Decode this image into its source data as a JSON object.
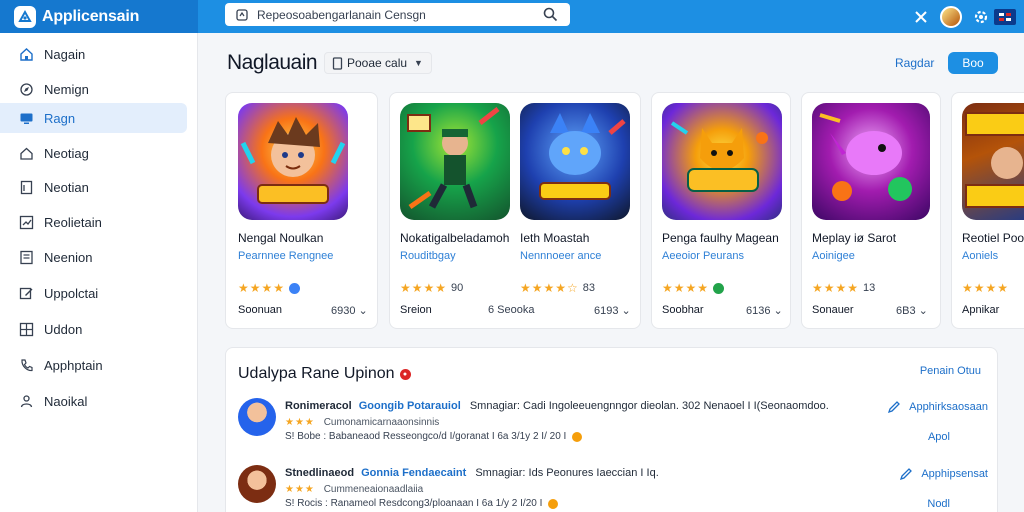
{
  "header": {
    "app_title": "Applicensain",
    "search_placeholder": "Repeosoabengarlanain Censgn",
    "accent": "#1d8fe3"
  },
  "sidebar": {
    "items": [
      {
        "label": "Nagain",
        "icon": "home-icon"
      },
      {
        "label": "Nemign",
        "icon": "compass-icon"
      },
      {
        "label": "Ragn",
        "icon": "monitor-icon",
        "active": true
      },
      {
        "label": "Neotiag",
        "icon": "house-icon"
      },
      {
        "label": "Neotian",
        "icon": "document-icon"
      },
      {
        "label": "Reolietain",
        "icon": "chart-icon"
      },
      {
        "label": "Neenion",
        "icon": "list-icon"
      },
      {
        "label": "Uppolctai",
        "icon": "edit-icon"
      },
      {
        "label": "Uddon",
        "icon": "grid-icon"
      },
      {
        "label": "Apphptain",
        "icon": "phone-icon"
      },
      {
        "label": "Naoikal",
        "icon": "person-icon"
      }
    ]
  },
  "main": {
    "title": "Naglauain",
    "filter_label": "Pooae calu",
    "link_label": "Ragdar",
    "button_label": "Boo"
  },
  "apps": [
    {
      "name": "Nengal Noulkan",
      "developer": "Pearnnee Rengnee",
      "stars": "★★★★",
      "rating": "",
      "badge": "#3b82f6",
      "foot_left": "Soonuan",
      "foot_right": "6930"
    },
    {
      "name": "Nokatigalbeladamoh",
      "developer": "Rouditbgay",
      "stars": "★★★★",
      "rating": "90",
      "badge": "",
      "foot_left": "Sreion",
      "foot_right": "6 Seooka"
    },
    {
      "name": "Ieth Moastah",
      "developer": "Nennnoeer ance",
      "stars": "★★★★☆",
      "rating": "83",
      "badge": "",
      "foot_left": "",
      "foot_right": "6193"
    },
    {
      "name": "Penga faulhy Magean",
      "developer": "Aeeoior Peurans",
      "stars": "★★★★",
      "rating": "",
      "badge": "#22a34a",
      "foot_left": "Soobhar",
      "foot_right": "6136"
    },
    {
      "name": "Meplay iø Sarot",
      "developer": "Aoinigee",
      "stars": "★★★★",
      "rating": "13",
      "badge": "",
      "foot_left": "Sonauer",
      "foot_right": "6B3"
    },
    {
      "name": "Reotiel Poor",
      "developer": "Aoniels",
      "stars": "★★★★",
      "rating": "",
      "badge": "",
      "foot_left": "Apnikar",
      "foot_right": ""
    }
  ],
  "reviews": {
    "title": "Udalypa  Rane Upinon",
    "link": "Penain Otuu",
    "items": [
      {
        "user": "Ronimeracol",
        "app": "Goongib Potarauiol",
        "text": "Smnagiar: Cadi Ingoleeuengnngor dieolan. 302 Nenaoel I I(Seonaomdoo.",
        "stars": "★★★",
        "meta": "Cumonamicarnaaonsinnis",
        "date": "S! Bobe : Babaneaod Resseongco/d I/goranat I 6a 3/1y 2 I/ 20 I",
        "action": "Apphirksaosaan",
        "reply": "Apol"
      },
      {
        "user": "Stnedlinaeod",
        "app": "Gonnia Fendaecaint",
        "text": "Smnagiar: Ids Peonures Iaeccian I Iq.",
        "stars": "★★★",
        "meta": "Cummeneaionaadlaiia",
        "date": "S! Rocis : Ranameol Resdcong3/ploanaan I 6a 1/y 2 I/20 I",
        "action": "Apphipsensat",
        "reply": "Nodl"
      }
    ]
  }
}
